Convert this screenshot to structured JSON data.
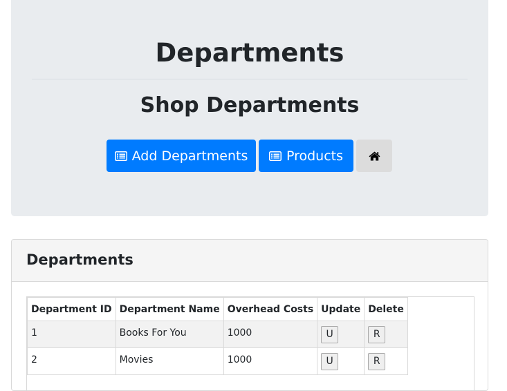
{
  "jumbotron": {
    "title": "Departments",
    "subtitle": "Shop Departments",
    "buttons": {
      "add_label": "Add Departments",
      "products_label": "Products",
      "home_icon": "home-icon"
    }
  },
  "card": {
    "title": "Departments",
    "table": {
      "headers": [
        "Department ID",
        "Department Name",
        "Overhead Costs",
        "Update",
        "Delete"
      ],
      "rows": [
        {
          "id": "1",
          "name": "Books For You",
          "cost": "1000",
          "update": "U",
          "delete": "R"
        },
        {
          "id": "2",
          "name": "Movies",
          "cost": "1000",
          "update": "U",
          "delete": "R"
        }
      ]
    }
  },
  "colors": {
    "primary": "#007bff",
    "jumbotron_bg": "#e9ecef",
    "home_btn_bg": "#dcdcdc"
  }
}
